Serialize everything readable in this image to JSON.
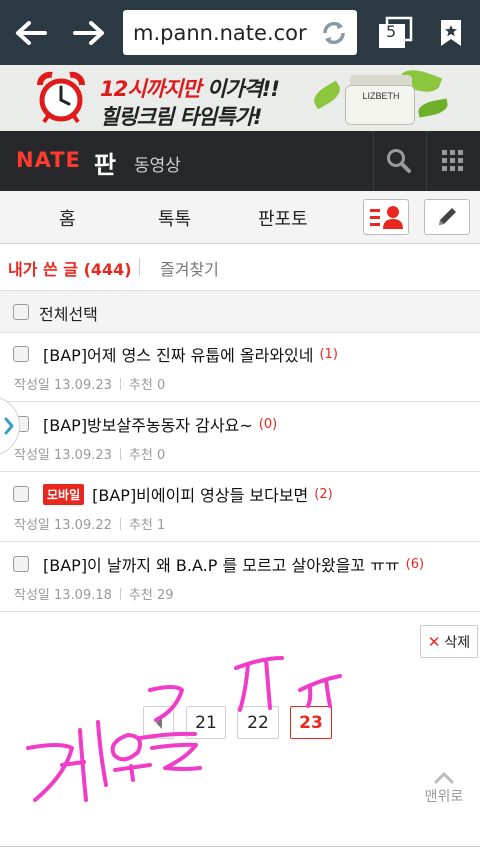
{
  "browser": {
    "url": "m.pann.nate.cor",
    "tab_count": "5"
  },
  "ad": {
    "line1_red": "12시까지만",
    "line1_dark": "이가격!!",
    "line2": "힐링크림 타임특가!",
    "brand": "LIZBETH"
  },
  "header": {
    "logo": "NATE",
    "pan": "판",
    "video": "동영상"
  },
  "tabs": [
    "홈",
    "톡톡",
    "판포토"
  ],
  "my_tabs": {
    "active": "내가 쓴 글 (444)",
    "other": "즐겨찾기"
  },
  "select_all": "전체선택",
  "posts": [
    {
      "title": "[BAP]어제 영스 진짜 유툽에 올라와있네",
      "count": "(1)",
      "date": "작성일 13.09.23",
      "recommend": "추천 0",
      "badge": ""
    },
    {
      "title": "[BAP]방보살주농동자 감사요~",
      "count": "(0)",
      "date": "작성일 13.09.23",
      "recommend": "추천 0",
      "badge": ""
    },
    {
      "title": "[BAP]비에이피 영상들 보다보면",
      "count": "(2)",
      "date": "작성일 13.09.22",
      "recommend": "추천 1",
      "badge": "모바일"
    },
    {
      "title": "[BAP]이 날까지 왜 B.A.P 를 모르고 살아왔을꼬 ㅠㅠ",
      "count": "(6)",
      "date": "작성일 13.09.18",
      "recommend": "추천 29",
      "badge": ""
    }
  ],
  "delete_label": "삭제",
  "pagination": {
    "pages": [
      "21",
      "22",
      "23"
    ],
    "current": "23"
  },
  "to_top": "맨위로",
  "colors": {
    "accent_red": "#e8281e",
    "header_bg": "#26282c",
    "browser_bg": "#2b3a42",
    "scribble": "#f03cc8"
  }
}
